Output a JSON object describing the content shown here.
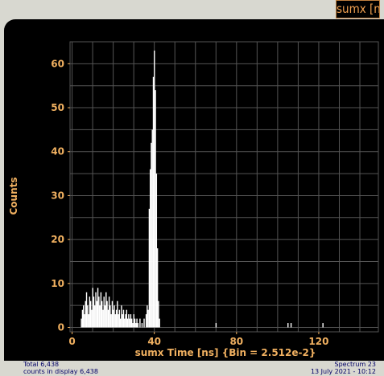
{
  "window": {
    "title": "sumx [ns]"
  },
  "footer": {
    "total": "Total 6,438",
    "counts_in_display": "counts in display 6,438",
    "spectrum": "Spectrum 23",
    "date": "13 July 2021 - 10:12"
  },
  "colors": {
    "background": "#000000",
    "frame": "#d8d8d0",
    "axis_text": "#f0b060",
    "grid": "#555555",
    "data": "#ffffff",
    "footer_text": "#000066"
  },
  "chart_data": {
    "type": "bar",
    "title": "",
    "xlabel": "sumx Time [ns] {Bin = 2.512e-2}",
    "ylabel": "Counts",
    "xlim": [
      -1,
      149
    ],
    "ylim": [
      -1,
      65
    ],
    "xticks": [
      0,
      40,
      80,
      120
    ],
    "yticks": [
      0,
      10,
      20,
      30,
      40,
      50,
      60
    ],
    "grid": true,
    "legend": "none",
    "series": [
      {
        "values_note": "histogram bins as [x, count]",
        "points": [
          [
            4.5,
            2
          ],
          [
            5.0,
            4
          ],
          [
            5.5,
            5
          ],
          [
            6.0,
            3
          ],
          [
            6.5,
            6
          ],
          [
            7.0,
            8
          ],
          [
            7.5,
            5
          ],
          [
            8.0,
            3
          ],
          [
            8.5,
            7
          ],
          [
            9.0,
            6
          ],
          [
            9.5,
            4
          ],
          [
            10.0,
            9
          ],
          [
            10.5,
            7
          ],
          [
            11.0,
            5
          ],
          [
            11.5,
            8
          ],
          [
            12.0,
            6
          ],
          [
            12.5,
            9
          ],
          [
            13.0,
            7
          ],
          [
            13.5,
            5
          ],
          [
            14.0,
            8
          ],
          [
            14.5,
            6
          ],
          [
            15.0,
            4
          ],
          [
            15.5,
            7
          ],
          [
            16.0,
            5
          ],
          [
            16.5,
            8
          ],
          [
            17.0,
            6
          ],
          [
            17.5,
            4
          ],
          [
            18.0,
            7
          ],
          [
            18.5,
            5
          ],
          [
            19.0,
            3
          ],
          [
            19.5,
            6
          ],
          [
            20.0,
            4
          ],
          [
            20.5,
            5
          ],
          [
            21.0,
            3
          ],
          [
            21.5,
            4
          ],
          [
            22.0,
            6
          ],
          [
            22.5,
            3
          ],
          [
            23.0,
            4
          ],
          [
            23.5,
            2
          ],
          [
            24.0,
            5
          ],
          [
            24.5,
            3
          ],
          [
            25.0,
            4
          ],
          [
            25.5,
            2
          ],
          [
            26.0,
            3
          ],
          [
            26.5,
            4
          ],
          [
            27.0,
            2
          ],
          [
            27.5,
            3
          ],
          [
            28.0,
            2
          ],
          [
            28.5,
            3
          ],
          [
            29.0,
            2
          ],
          [
            29.5,
            1
          ],
          [
            30.0,
            3
          ],
          [
            30.5,
            2
          ],
          [
            31.0,
            1
          ],
          [
            31.5,
            2
          ],
          [
            32.0,
            1
          ],
          [
            33.0,
            2
          ],
          [
            34.0,
            1
          ],
          [
            35.0,
            2
          ],
          [
            36.0,
            3
          ],
          [
            36.5,
            5
          ],
          [
            37.0,
            4
          ],
          [
            37.5,
            27
          ],
          [
            38.0,
            36
          ],
          [
            38.5,
            42
          ],
          [
            39.0,
            45
          ],
          [
            39.5,
            57
          ],
          [
            40.0,
            63
          ],
          [
            40.5,
            54
          ],
          [
            41.0,
            35
          ],
          [
            41.5,
            18
          ],
          [
            42.0,
            6
          ],
          [
            42.5,
            2
          ],
          [
            70.0,
            1
          ],
          [
            105.0,
            1
          ],
          [
            106.5,
            1
          ],
          [
            122.0,
            1
          ]
        ]
      }
    ]
  }
}
